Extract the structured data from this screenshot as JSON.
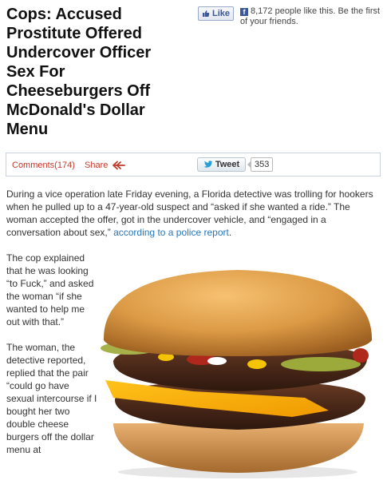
{
  "article": {
    "headline": "Cops: Accused Prostitute Offered Undercover Officer Sex For Cheeseburgers Off McDonald's Dollar Menu",
    "intro_text": "During a vice operation late Friday evening, a Florida detective was trolling for hookers when he pulled up to a 47-year-old suspect and “asked if she wanted a ride.” The woman accepted the offer, got in the undercover vehicle, and “engaged in a conversation about sex,” ",
    "intro_link": "according to a police report",
    "intro_end": ".",
    "paragraph_2": "The cop explained that he was looking “to Fuck,” and asked the woman “if she wanted to help me out with that.”",
    "paragraph_3": "The woman, the detective reported, replied that the pair “could go have sexual intercourse if I bought her two double cheese burgers off the dollar menu at"
  },
  "facebook": {
    "like_label": "Like",
    "count_text": "8,172 people like this. Be the first of your friends.",
    "logo_letter": "f",
    "icon": "thumbs-up-icon",
    "color": "#3b5998"
  },
  "share_bar": {
    "comments_label": "Comments(174)",
    "share_label": "Share",
    "share_icon": "share-arrow-icon",
    "tweet_label": "Tweet",
    "tweet_icon": "twitter-bird-icon",
    "tweet_count": "353",
    "accent_color": "#c0392b"
  },
  "image": {
    "subject": "double-cheeseburger-image"
  }
}
